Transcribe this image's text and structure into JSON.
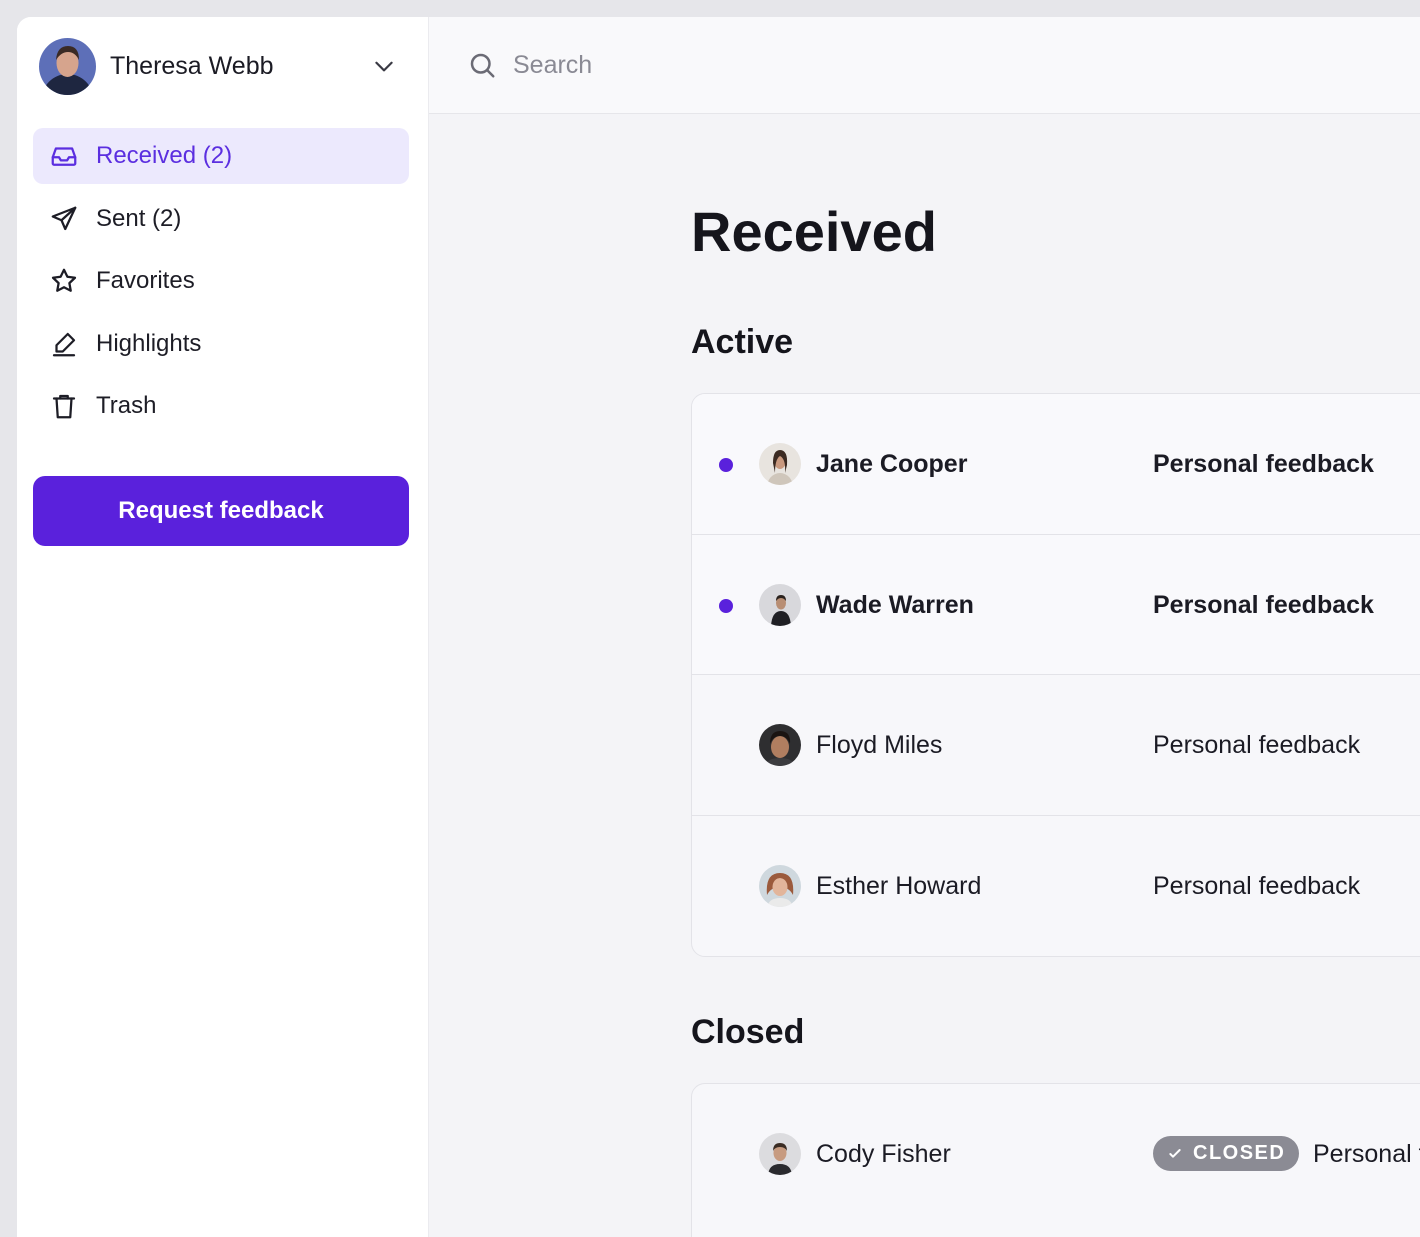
{
  "user": {
    "name": "Theresa Webb",
    "menu_icon": "chevron-down-icon"
  },
  "nav": {
    "items": [
      {
        "label": "Received (2)",
        "icon": "inbox-icon",
        "active": true
      },
      {
        "label": "Sent (2)",
        "icon": "send-icon",
        "active": false
      },
      {
        "label": "Favorites",
        "icon": "star-icon",
        "active": false
      },
      {
        "label": "Highlights",
        "icon": "highlighter-icon",
        "active": false
      },
      {
        "label": "Trash",
        "icon": "trash-icon",
        "active": false
      }
    ],
    "cta_label": "Request feedback"
  },
  "search": {
    "placeholder": "Search",
    "value": ""
  },
  "page": {
    "title": "Received",
    "active_title": "Active",
    "closed_title": "Closed"
  },
  "active_items": [
    {
      "name": "Jane Cooper",
      "type": "Personal feedback",
      "unread": true
    },
    {
      "name": "Wade Warren",
      "type": "Personal feedback",
      "unread": true
    },
    {
      "name": "Floyd Miles",
      "type": "Personal feedback",
      "unread": false
    },
    {
      "name": "Esther Howard",
      "type": "Personal feedback",
      "unread": false
    }
  ],
  "closed_items": [
    {
      "name": "Cody Fisher",
      "status": "CLOSED",
      "type": "Personal feedback"
    }
  ],
  "colors": {
    "accent": "#5a21dc",
    "active_nav_bg": "#ece9fd",
    "badge_bg": "#8b8b94"
  }
}
